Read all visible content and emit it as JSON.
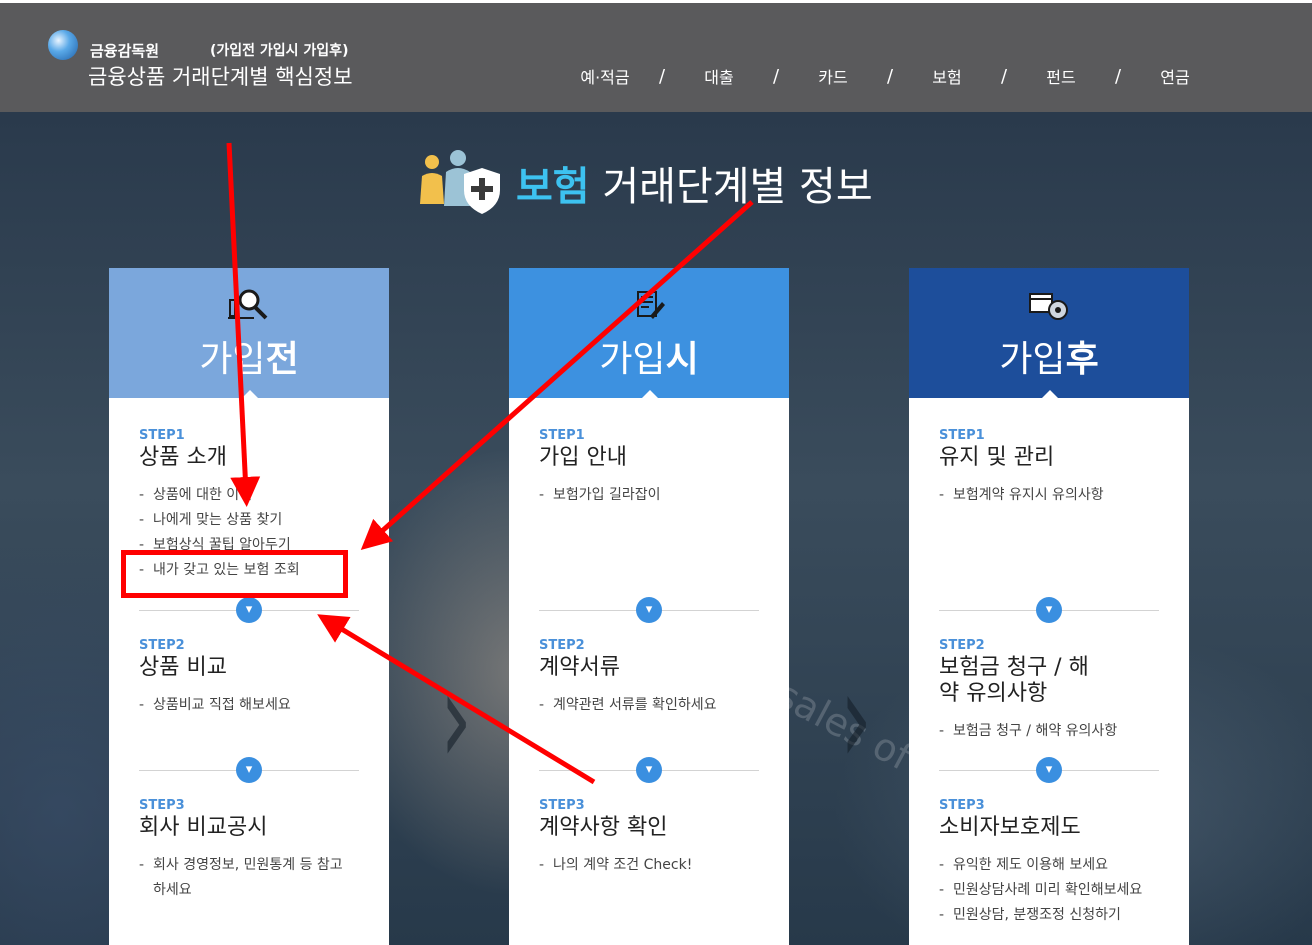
{
  "header": {
    "org_name": "금융감독원",
    "stages_label": "(가입전 가입시 가입후)",
    "site_title": "금융상품 거래단계별 핵심정보",
    "nav": [
      {
        "label": "예·적금"
      },
      {
        "label": "대출"
      },
      {
        "label": "카드"
      },
      {
        "label": "보험"
      },
      {
        "label": "펀드"
      },
      {
        "label": "연금"
      }
    ],
    "nav_separator": "/"
  },
  "page": {
    "title_highlight": "보험",
    "title_rest": "거래단계별 정보",
    "background_text": "sales of ma"
  },
  "cards": [
    {
      "title_light": "가입",
      "title_bold": "전",
      "header_color": "#7ba7dc",
      "icon": "magnifier-chart-icon",
      "steps": [
        {
          "label": "STEP1",
          "title": "상품 소개",
          "items": [
            "상품에 대한 이해",
            "나에게 맞는 상품 찾기",
            "보험상식 꿀팁 알아두기",
            "내가 갖고 있는 보험 조회"
          ]
        },
        {
          "label": "STEP2",
          "title": "상품 비교",
          "items": [
            "상품비교 직접 해보세요"
          ]
        },
        {
          "label": "STEP3",
          "title": "회사 비교공시",
          "items": [
            "회사 경영정보, 민원통계 등 참고하세요"
          ]
        }
      ]
    },
    {
      "title_light": "가입",
      "title_bold": "시",
      "header_color": "#3d91e0",
      "icon": "document-pen-icon",
      "steps": [
        {
          "label": "STEP1",
          "title": "가입 안내",
          "items": [
            "보험가입 길라잡이"
          ]
        },
        {
          "label": "STEP2",
          "title": "계약서류",
          "items": [
            "계약관련 서류를 확인하세요"
          ]
        },
        {
          "label": "STEP3",
          "title": "계약사항 확인",
          "items": [
            "나의 계약 조건 Check!"
          ]
        }
      ]
    },
    {
      "title_light": "가입",
      "title_bold": "후",
      "header_color": "#1d4e9b",
      "icon": "calendar-gear-icon",
      "steps": [
        {
          "label": "STEP1",
          "title": "유지 및 관리",
          "items": [
            "보험계약 유지시 유의사항"
          ]
        },
        {
          "label": "STEP2",
          "title": "보험금 청구 / 해약 유의사항",
          "items": [
            "보험금 청구 / 해약 유의사항"
          ]
        },
        {
          "label": "STEP3",
          "title": "소비자보호제도",
          "items": [
            "유익한 제도 이용해 보세요",
            "민원상담사례 미리 확인해보세요",
            "민원상담, 분쟁조정 신청하기"
          ]
        }
      ]
    }
  ],
  "colors": {
    "accent": "#3dc2f0",
    "step_label": "#4a90d9",
    "annotation": "#ff0000"
  }
}
